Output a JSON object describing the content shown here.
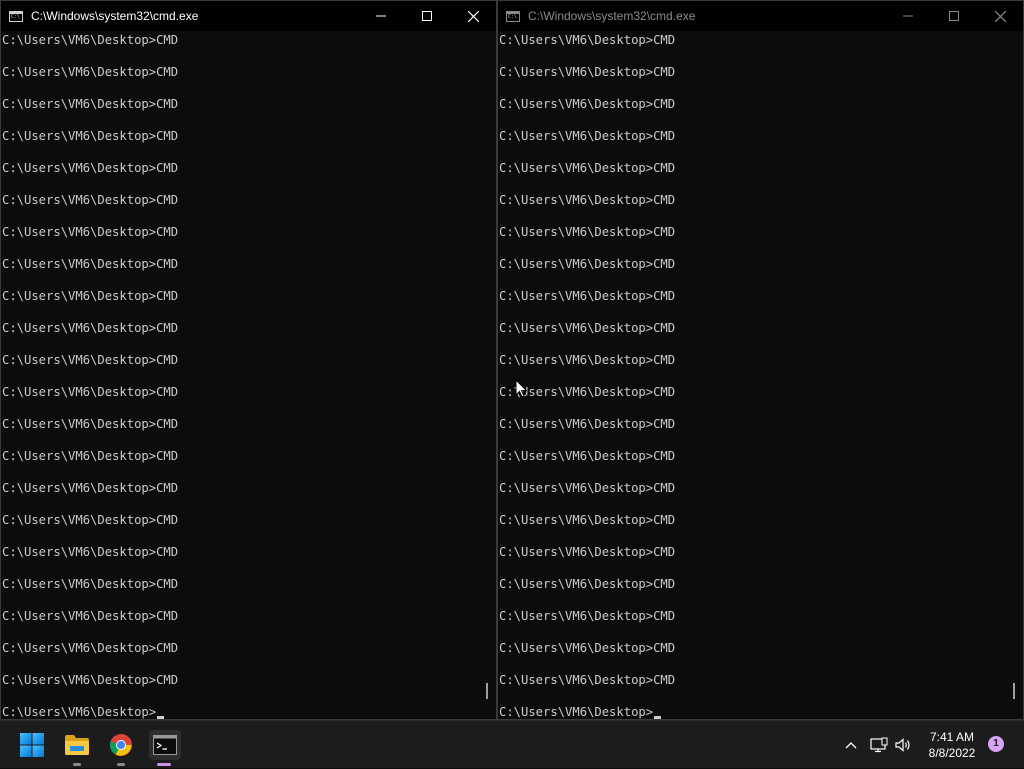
{
  "windows": [
    {
      "title": "C:\\Windows\\system32\\cmd.exe",
      "active": true,
      "lines": [
        "C:\\Users\\VM6\\Desktop>CMD",
        "C:\\Users\\VM6\\Desktop>CMD",
        "C:\\Users\\VM6\\Desktop>CMD",
        "C:\\Users\\VM6\\Desktop>CMD",
        "C:\\Users\\VM6\\Desktop>CMD",
        "C:\\Users\\VM6\\Desktop>CMD",
        "C:\\Users\\VM6\\Desktop>CMD",
        "C:\\Users\\VM6\\Desktop>CMD",
        "C:\\Users\\VM6\\Desktop>CMD",
        "C:\\Users\\VM6\\Desktop>CMD",
        "C:\\Users\\VM6\\Desktop>CMD",
        "C:\\Users\\VM6\\Desktop>CMD",
        "C:\\Users\\VM6\\Desktop>CMD",
        "C:\\Users\\VM6\\Desktop>CMD",
        "C:\\Users\\VM6\\Desktop>CMD",
        "C:\\Users\\VM6\\Desktop>CMD",
        "C:\\Users\\VM6\\Desktop>CMD",
        "C:\\Users\\VM6\\Desktop>CMD",
        "C:\\Users\\VM6\\Desktop>CMD",
        "C:\\Users\\VM6\\Desktop>CMD",
        "C:\\Users\\VM6\\Desktop>CMD"
      ],
      "prompt": "C:\\Users\\VM6\\Desktop>"
    },
    {
      "title": "C:\\Windows\\system32\\cmd.exe",
      "active": false,
      "lines": [
        "C:\\Users\\VM6\\Desktop>CMD",
        "C:\\Users\\VM6\\Desktop>CMD",
        "C:\\Users\\VM6\\Desktop>CMD",
        "C:\\Users\\VM6\\Desktop>CMD",
        "C:\\Users\\VM6\\Desktop>CMD",
        "C:\\Users\\VM6\\Desktop>CMD",
        "C:\\Users\\VM6\\Desktop>CMD",
        "C:\\Users\\VM6\\Desktop>CMD",
        "C:\\Users\\VM6\\Desktop>CMD",
        "C:\\Users\\VM6\\Desktop>CMD",
        "C:\\Users\\VM6\\Desktop>CMD",
        "C:\\Users\\VM6\\Desktop>CMD",
        "C:\\Users\\VM6\\Desktop>CMD",
        "C:\\Users\\VM6\\Desktop>CMD",
        "C:\\Users\\VM6\\Desktop>CMD",
        "C:\\Users\\VM6\\Desktop>CMD",
        "C:\\Users\\VM6\\Desktop>CMD",
        "C:\\Users\\VM6\\Desktop>CMD",
        "C:\\Users\\VM6\\Desktop>CMD",
        "C:\\Users\\VM6\\Desktop>CMD",
        "C:\\Users\\VM6\\Desktop>CMD"
      ],
      "prompt": "C:\\Users\\VM6\\Desktop>"
    }
  ],
  "taskbar": {
    "apps": [
      {
        "name": "start-icon"
      },
      {
        "name": "file-explorer-icon"
      },
      {
        "name": "chrome-icon"
      },
      {
        "name": "terminal-icon"
      }
    ],
    "tray": {
      "time": "7:41 AM",
      "date": "8/8/2022",
      "notification_count": "1"
    }
  },
  "colors": {
    "console_bg": "#0c0c0c",
    "console_fg": "#cccccc",
    "taskbar_bg": "#1c1c1c",
    "accent": "#c994e6"
  }
}
